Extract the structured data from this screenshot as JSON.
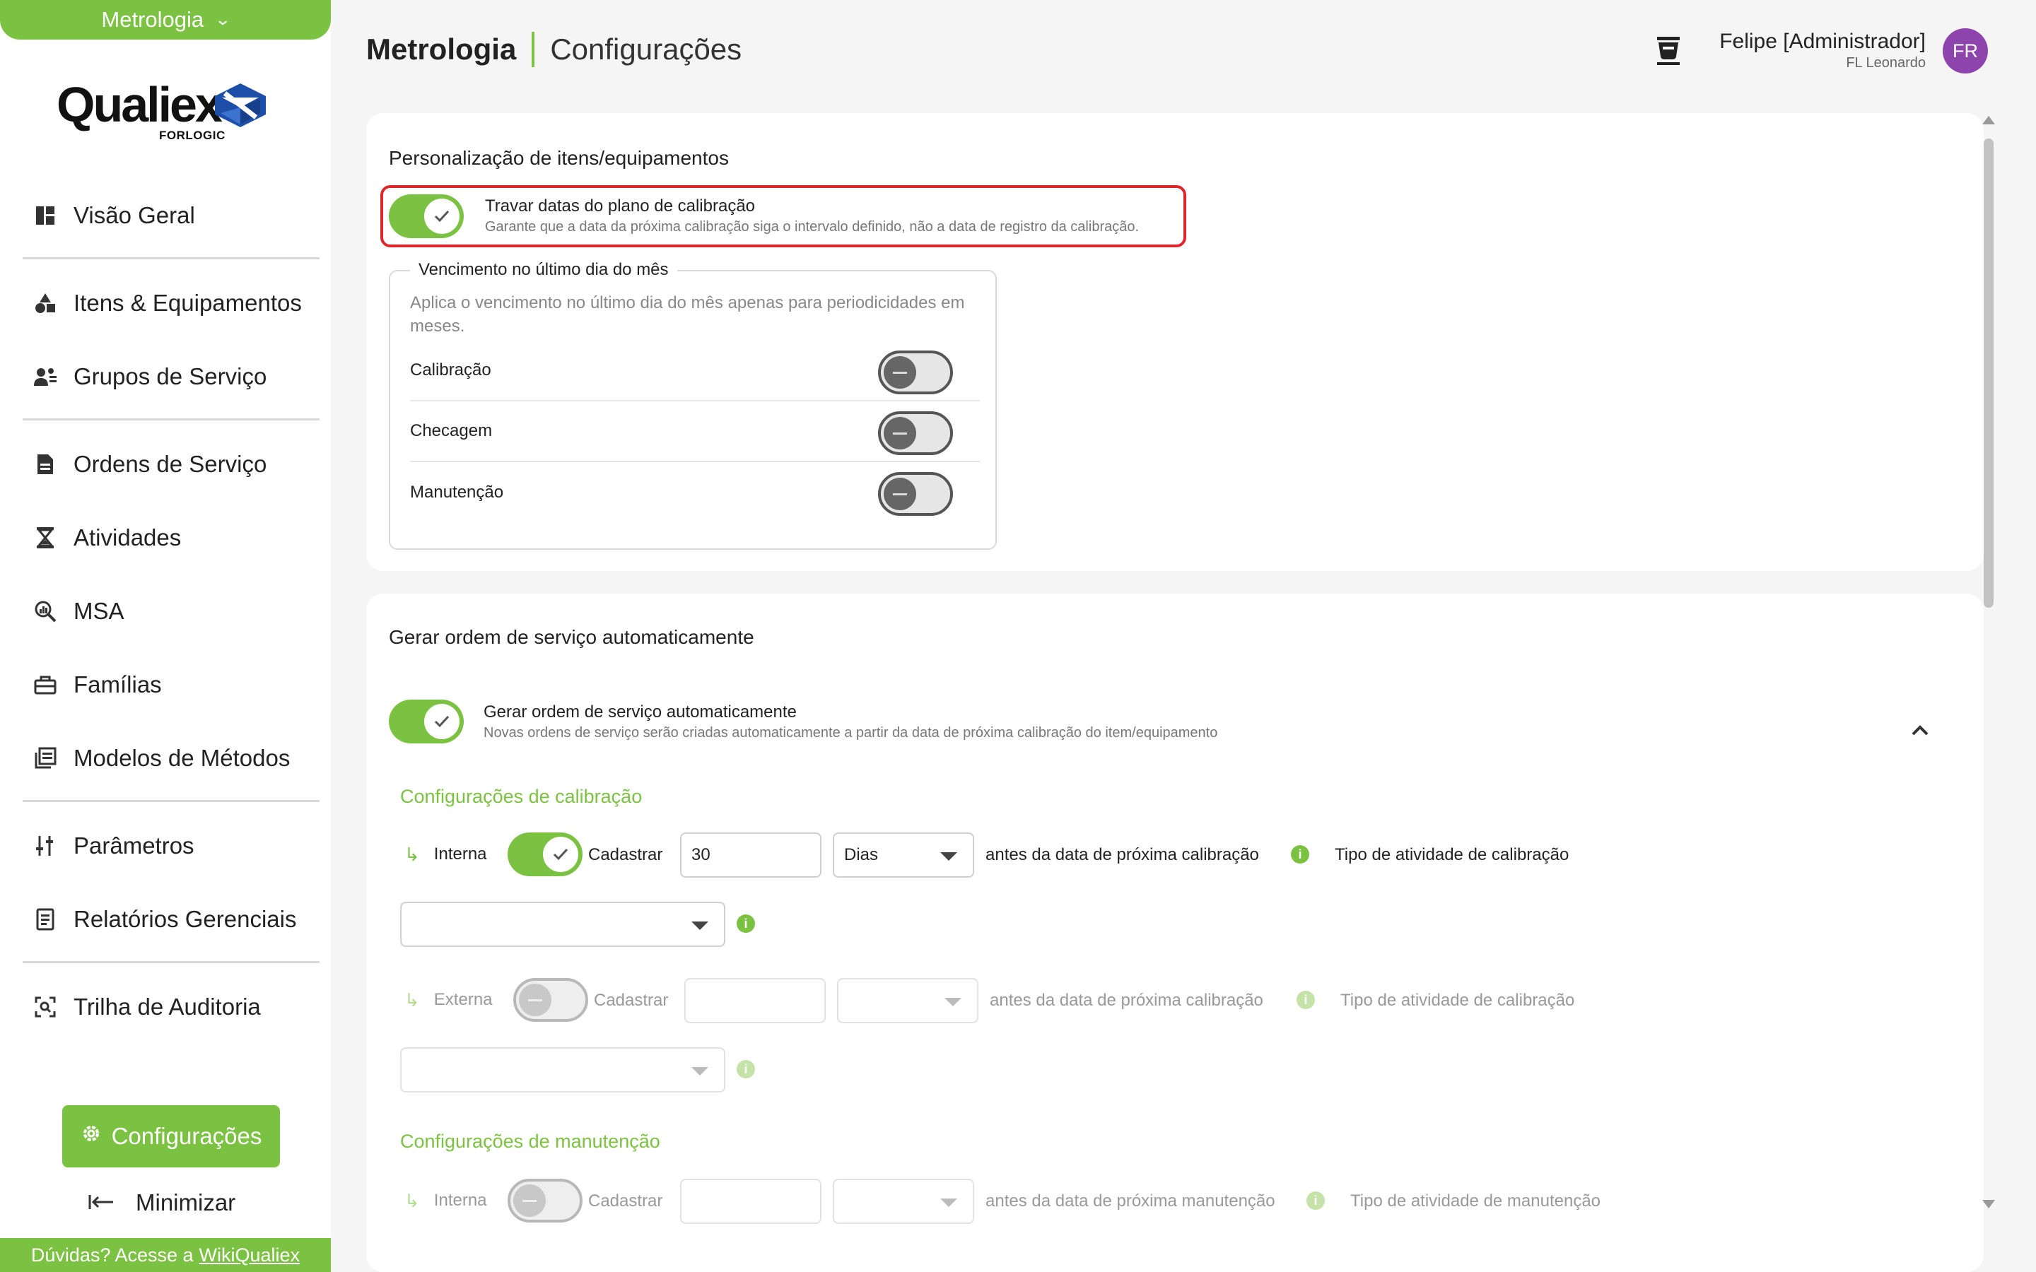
{
  "app_switcher": {
    "label": "Metrologia"
  },
  "logo": {
    "brand": "Qualiex",
    "sub": "FORLOGIC"
  },
  "sidebar": {
    "items": [
      {
        "label": "Visão Geral",
        "icon": "dashboard-icon"
      },
      {
        "label": "Itens & Equipamentos",
        "icon": "shapes-icon"
      },
      {
        "label": "Grupos de Serviço",
        "icon": "group-icon"
      },
      {
        "label": "Ordens de Serviço",
        "icon": "document-icon"
      },
      {
        "label": "Atividades",
        "icon": "hourglass-icon"
      },
      {
        "label": "MSA",
        "icon": "magnify-chart-icon"
      },
      {
        "label": "Famílias",
        "icon": "toolbox-icon"
      },
      {
        "label": "Modelos de Métodos",
        "icon": "library-icon"
      },
      {
        "label": "Parâmetros",
        "icon": "sliders-icon"
      },
      {
        "label": "Relatórios Gerenciais",
        "icon": "report-icon"
      },
      {
        "label": "Trilha de Auditoria",
        "icon": "audit-icon"
      }
    ],
    "config_button": "Configurações",
    "minimize": "Minimizar",
    "help_text": "Dúvidas? Acesse a",
    "help_link": "WikiQualiex"
  },
  "header": {
    "app": "Metrologia",
    "section": "Configurações",
    "user_name": "Felipe [Administrador]",
    "user_sub": "FL Leonardo",
    "avatar_initials": "FR"
  },
  "card1": {
    "title": "Personalização de itens/equipamentos",
    "lock_toggle": {
      "label": "Travar datas do plano de calibração",
      "description": "Garante que a data da próxima calibração siga o intervalo definido, não a data de registro da calibração.",
      "state": "on"
    },
    "fieldset": {
      "legend": "Vencimento no último dia do mês",
      "description": "Aplica o vencimento no último dia do mês apenas para periodicidades em meses.",
      "rows": [
        {
          "label": "Calibração",
          "state": "off"
        },
        {
          "label": "Checagem",
          "state": "off"
        },
        {
          "label": "Manutenção",
          "state": "off"
        }
      ]
    }
  },
  "card2": {
    "title": "Gerar ordem de serviço automaticamente",
    "auto_toggle": {
      "label": "Gerar ordem de serviço automaticamente",
      "description": "Novas ordens de serviço serão criadas automaticamente a partir da data de próxima calibração do item/equipamento",
      "state": "on"
    },
    "calibration": {
      "title": "Configurações de calibração",
      "interna": {
        "label": "Interna",
        "cadastrar": "Cadastrar",
        "days_value": "30",
        "unit": "Dias",
        "before_text": "antes da data de próxima calibração",
        "activity_label": "Tipo de atividade de calibração",
        "activity_value": ""
      },
      "externa": {
        "label": "Externa",
        "cadastrar": "Cadastrar",
        "days_value": "",
        "unit": "",
        "before_text": "antes da data de próxima calibração",
        "activity_label": "Tipo de atividade de calibração",
        "activity_value": ""
      }
    },
    "maintenance": {
      "title": "Configurações de manutenção",
      "interna": {
        "label": "Interna",
        "cadastrar": "Cadastrar",
        "days_value": "",
        "unit": "",
        "before_text": "antes da data de próxima manutenção",
        "activity_label": "Tipo de atividade de manutenção"
      }
    }
  },
  "colors": {
    "accent": "#7cc242",
    "highlight": "#e0262a",
    "avatar": "#8e44ad"
  }
}
